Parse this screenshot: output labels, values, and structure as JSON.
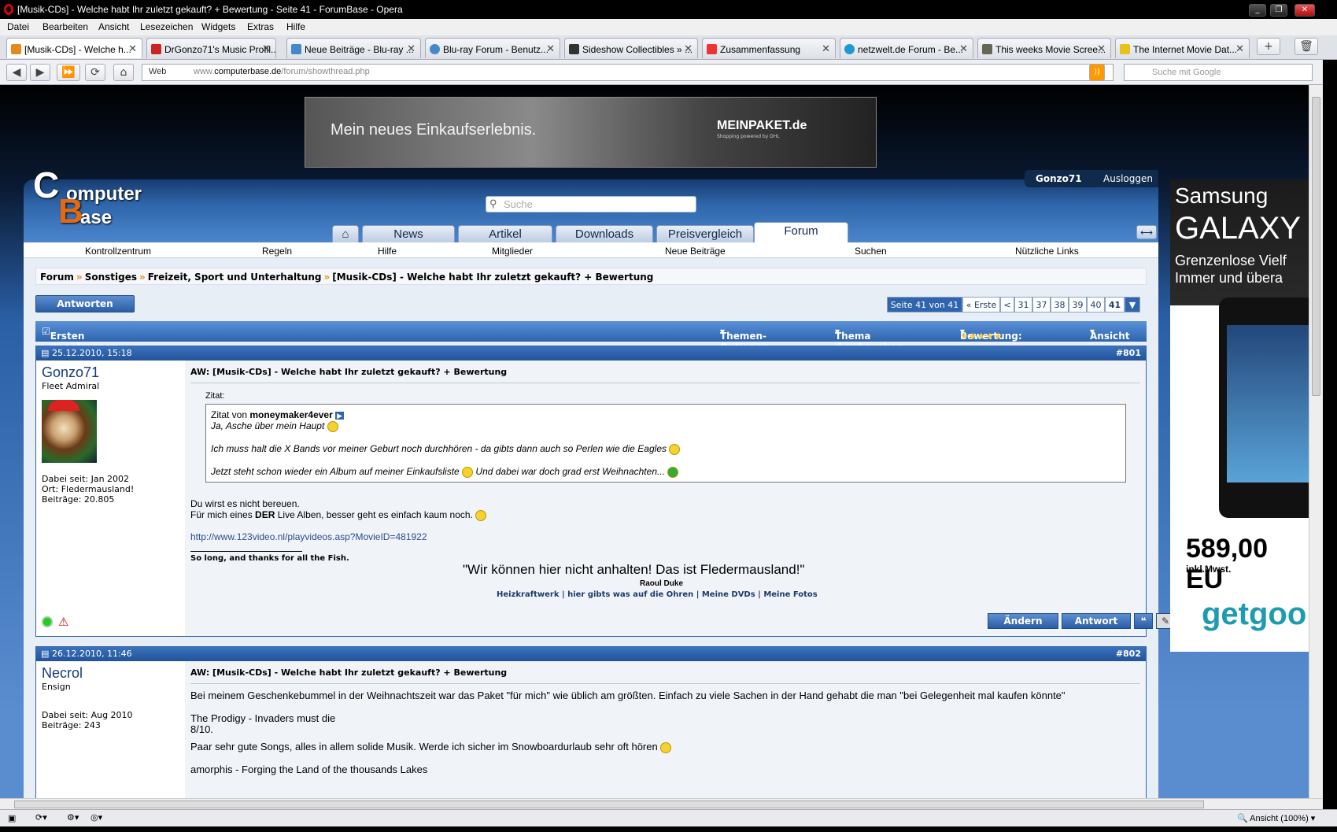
{
  "window": {
    "title": "[Musik-CDs] - Welche habt Ihr zuletzt gekauft? + Bewertung - Seite 41 - ForumBase - Opera"
  },
  "menu": [
    "Datei",
    "Bearbeiten",
    "Ansicht",
    "Lesezeichen",
    "Widgets",
    "Extras",
    "Hilfe"
  ],
  "tabs": [
    {
      "label": "[Musik-CDs] - Welche h..."
    },
    {
      "label": "DrGonzo71's Music Profil..."
    },
    {
      "label": "Neue Beiträge - Blu-ray ..."
    },
    {
      "label": "Blu-ray Forum - Benutz..."
    },
    {
      "label": "Sideshow Collectibles » ..."
    },
    {
      "label": "Zusammenfassung"
    },
    {
      "label": "netzwelt.de Forum - Be..."
    },
    {
      "label": "This weeks Movie Scree..."
    },
    {
      "label": "The Internet Movie Dat..."
    }
  ],
  "address": {
    "label": "Web",
    "url_prefix": "www.",
    "url_domain": "computerbase.de",
    "url_path": "/forum/showthread.php",
    "search_placeholder": "Suche mit Google"
  },
  "banner": {
    "text": "Mein neues Einkaufserlebnis.",
    "brand": "MEINPAKET.de",
    "brand_sub": "Shopping powered by DHL"
  },
  "site": {
    "logo": [
      "C",
      "omputer",
      "B",
      "ase"
    ],
    "search_placeholder": "Suche",
    "user": "Gonzo71",
    "logout": "Ausloggen",
    "nav": [
      "News",
      "Artikel",
      "Downloads",
      "Preisvergleich",
      "Forum"
    ],
    "subnav": [
      "Kontrollzentrum",
      "Regeln",
      "Hilfe",
      "Mitglieder",
      "Neue Beiträge",
      "Suchen",
      "Nützliche Links"
    ]
  },
  "breadcrumb": [
    "Forum",
    "Sonstiges",
    "Freizeit, Sport und Unterhaltung",
    "[Musik-CDs] - Welche habt Ihr zuletzt gekauft? + Bewertung"
  ],
  "reply_button": "Antworten",
  "pager": {
    "label": "Seite 41 von 41",
    "first": "« Erste",
    "prev": "<",
    "pages": [
      "31",
      "37",
      "38",
      "39",
      "40",
      "41"
    ]
  },
  "thread_bar": {
    "first_unread": "Ersten ungelesenen Beitrag anzeigen",
    "options": "Themen-Optionen",
    "search": "Thema durchsuchen",
    "rating": "Bewertung:",
    "view": "Ansicht"
  },
  "posts": [
    {
      "date": "25.12.2010, 15:18",
      "number": "#801",
      "user": "Gonzo71",
      "rank": "Fleet Admiral",
      "joined": "Dabei seit: Jan 2002",
      "location": "Ort: Fledermausland!",
      "posts": "Beiträge: 20.805",
      "title": "AW: [Musik-CDs] - Welche habt Ihr zuletzt gekauft? + Bewertung",
      "quote_label": "Zitat:",
      "quote_from": "Zitat von",
      "quote_user": "moneymaker4ever",
      "quote_lines": [
        "Ja, Asche über mein Haupt",
        "Ich muss halt die X Bands vor meiner Geburt noch durchhören - da gibts dann auch so Perlen wie die Eagles",
        "Jetzt steht schon wieder ein Album auf meiner Einkaufsliste",
        "Und dabei war doch grad erst Weihnachten..."
      ],
      "body1": "Du wirst es nicht bereuen.",
      "body2_pre": "Für mich eines",
      "body2_bold": "DER",
      "body2_post": "Live Alben, besser geht es einfach kaum noch.",
      "link": "http://www.123video.nl/playvideos.asp?MovieID=481922",
      "sig1": "So long, and thanks for all the Fish.",
      "sig_quote": "\"Wir können hier nicht anhalten! Das ist Fledermausland!\"",
      "sig_author": "Raoul Duke",
      "sig_links": [
        "Heizkraftwerk",
        "hier gibts was auf die Ohren",
        "Meine DVDs",
        "Meine Fotos"
      ],
      "edit": "Ändern",
      "answer": "Antwort"
    },
    {
      "date": "26.12.2010, 11:46",
      "number": "#802",
      "user": "Necrol",
      "rank": "Ensign",
      "joined": "Dabei seit: Aug 2010",
      "posts": "Beiträge: 243",
      "title": "AW: [Musik-CDs] - Welche habt Ihr zuletzt gekauft? + Bewertung",
      "lines": [
        "Bei meinem Geschenkebummel in der Weihnachtszeit war das Paket \"für mich\" wie üblich am größten. Einfach zu viele Sachen in der Hand gehabt die man \"bei Gelegenheit mal kaufen könnte\"",
        "The Prodigy - Invaders must die",
        "8/10.",
        "Paar sehr gute Songs, alles in allem solide Musik. Werde ich sicher im Snowboardurlaub sehr oft hören",
        "amorphis - Forging the Land of the thousands Lakes"
      ]
    }
  ],
  "ad": {
    "brand": "Samsung",
    "product": "GALAXY",
    "line1": "Grenzenlose Vielf",
    "line2": "Immer und übera",
    "price": "589,00 EU",
    "tax": "inkl.Mwst.",
    "shop": "getgoo"
  },
  "status": {
    "zoom": "Ansicht (100%)"
  }
}
